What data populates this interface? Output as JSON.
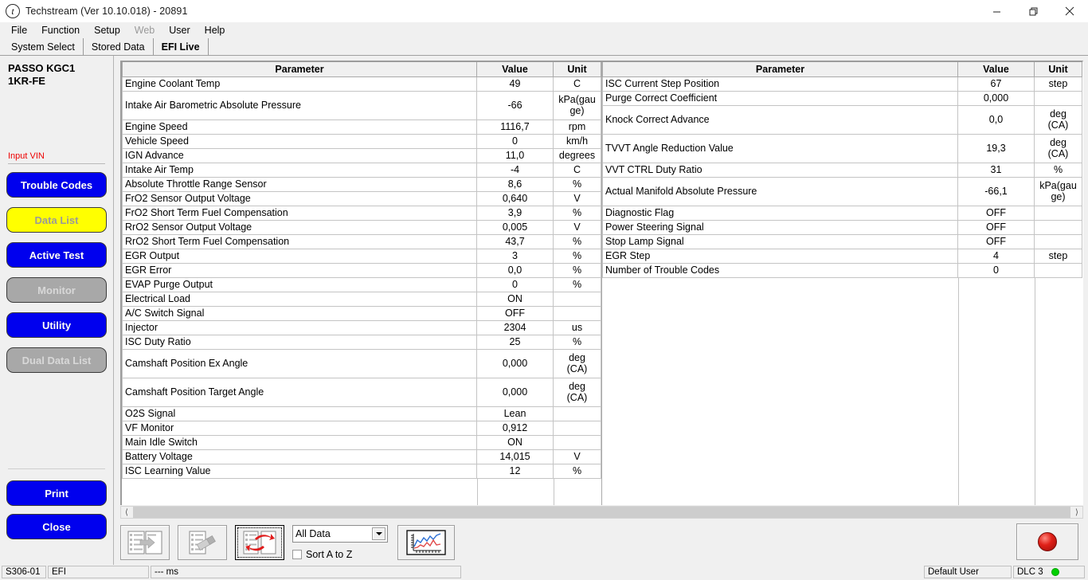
{
  "window": {
    "title": "Techstream (Ver 10.10.018) - 20891",
    "icon": "techstream-logo-icon",
    "minimize": "minimize-icon",
    "maximize": "restore-icon",
    "close": "close-icon"
  },
  "menubar": [
    {
      "label": "File",
      "disabled": false
    },
    {
      "label": "Function",
      "disabled": false
    },
    {
      "label": "Setup",
      "disabled": false
    },
    {
      "label": "Web",
      "disabled": true
    },
    {
      "label": "User",
      "disabled": false
    },
    {
      "label": "Help",
      "disabled": false
    }
  ],
  "tabs": [
    {
      "label": "System Select",
      "active": false
    },
    {
      "label": "Stored Data",
      "active": false
    },
    {
      "label": "EFI Live",
      "active": true
    }
  ],
  "sidebar": {
    "vehicle_line1": "PASSO KGC1",
    "vehicle_line2": "1KR-FE",
    "vin_label": "Input VIN",
    "buttons": [
      {
        "label": "Trouble Codes",
        "style": "blue"
      },
      {
        "label": "Data List",
        "style": "yellow"
      },
      {
        "label": "Active Test",
        "style": "blue"
      },
      {
        "label": "Monitor",
        "style": "gray"
      },
      {
        "label": "Utility",
        "style": "blue"
      },
      {
        "label": "Dual Data List",
        "style": "gray"
      }
    ],
    "bottom_buttons": [
      {
        "label": "Print",
        "style": "blue"
      },
      {
        "label": "Close",
        "style": "blue"
      }
    ]
  },
  "grid": {
    "headers": {
      "parameter": "Parameter",
      "value": "Value",
      "unit": "Unit"
    },
    "left_rows": [
      {
        "parameter": "Engine Coolant Temp",
        "value": "49",
        "unit": "C",
        "tall": false
      },
      {
        "parameter": "Intake Air Barometric Absolute Pressure",
        "value": "-66",
        "unit": "kPa(gauge)",
        "tall": true
      },
      {
        "parameter": "Engine Speed",
        "value": "1116,7",
        "unit": "rpm",
        "tall": false
      },
      {
        "parameter": "Vehicle Speed",
        "value": "0",
        "unit": "km/h",
        "tall": false
      },
      {
        "parameter": "IGN Advance",
        "value": "11,0",
        "unit": "degrees",
        "tall": false
      },
      {
        "parameter": "Intake Air Temp",
        "value": "-4",
        "unit": "C",
        "tall": false
      },
      {
        "parameter": "Absolute Throttle Range Sensor",
        "value": "8,6",
        "unit": "%",
        "tall": false
      },
      {
        "parameter": "FrO2 Sensor Output Voltage",
        "value": "0,640",
        "unit": "V",
        "tall": false
      },
      {
        "parameter": "FrO2 Short Term Fuel Compensation",
        "value": "3,9",
        "unit": "%",
        "tall": false
      },
      {
        "parameter": "RrO2 Sensor Output Voltage",
        "value": "0,005",
        "unit": "V",
        "tall": false
      },
      {
        "parameter": "RrO2 Short Term Fuel Compensation",
        "value": "43,7",
        "unit": "%",
        "tall": false
      },
      {
        "parameter": "EGR Output",
        "value": "3",
        "unit": "%",
        "tall": false
      },
      {
        "parameter": "EGR Error",
        "value": "0,0",
        "unit": "%",
        "tall": false
      },
      {
        "parameter": "EVAP Purge Output",
        "value": "0",
        "unit": "%",
        "tall": false
      },
      {
        "parameter": "Electrical Load",
        "value": "ON",
        "unit": "",
        "tall": false
      },
      {
        "parameter": "A/C Switch Signal",
        "value": "OFF",
        "unit": "",
        "tall": false
      },
      {
        "parameter": "Injector",
        "value": "2304",
        "unit": "us",
        "tall": false
      },
      {
        "parameter": "ISC Duty Ratio",
        "value": "25",
        "unit": "%",
        "tall": false
      },
      {
        "parameter": "Camshaft Position Ex Angle",
        "value": "0,000",
        "unit": "deg (CA)",
        "tall": true
      },
      {
        "parameter": "Camshaft Position Target Angle",
        "value": "0,000",
        "unit": "deg (CA)",
        "tall": true
      },
      {
        "parameter": "O2S Signal",
        "value": "Lean",
        "unit": "",
        "tall": false
      },
      {
        "parameter": "VF Monitor",
        "value": "0,912",
        "unit": "",
        "tall": false
      },
      {
        "parameter": "Main Idle Switch",
        "value": "ON",
        "unit": "",
        "tall": false
      },
      {
        "parameter": "Battery Voltage",
        "value": "14,015",
        "unit": "V",
        "tall": false
      },
      {
        "parameter": "ISC Learning Value",
        "value": "12",
        "unit": "%",
        "tall": false
      }
    ],
    "right_rows": [
      {
        "parameter": "ISC Current Step Position",
        "value": "67",
        "unit": "step",
        "tall": false
      },
      {
        "parameter": "Purge Correct Coefficient",
        "value": "0,000",
        "unit": "",
        "tall": false
      },
      {
        "parameter": "Knock Correct Advance",
        "value": "0,0",
        "unit": "deg (CA)",
        "tall": true
      },
      {
        "parameter": "TVVT Angle Reduction Value",
        "value": "19,3",
        "unit": "deg (CA)",
        "tall": true
      },
      {
        "parameter": "VVT CTRL Duty Ratio",
        "value": "31",
        "unit": "%",
        "tall": false
      },
      {
        "parameter": "Actual Manifold Absolute Pressure",
        "value": "-66,1",
        "unit": "kPa(gauge)",
        "tall": true
      },
      {
        "parameter": "Diagnostic Flag",
        "value": "OFF",
        "unit": "",
        "tall": false
      },
      {
        "parameter": "Power Steering Signal",
        "value": "OFF",
        "unit": "",
        "tall": false
      },
      {
        "parameter": "Stop Lamp Signal",
        "value": "OFF",
        "unit": "",
        "tall": false
      },
      {
        "parameter": "EGR Step",
        "value": "4",
        "unit": "step",
        "tall": false
      },
      {
        "parameter": "Number of Trouble Codes",
        "value": "0",
        "unit": "",
        "tall": false
      }
    ]
  },
  "scrollbar": {
    "left_arrow": "chevron-left-icon",
    "right_arrow": "chevron-right-icon"
  },
  "toolbar": {
    "buttons": [
      {
        "name": "move-to-list-icon",
        "selected": false
      },
      {
        "name": "clear-list-icon",
        "selected": false
      },
      {
        "name": "swap-lists-icon",
        "selected": true
      }
    ],
    "combo": {
      "value": "All Data",
      "arrow": "chevron-down-icon"
    },
    "checkbox": {
      "label": "Sort A to Z",
      "checked": false
    },
    "graph_button": {
      "name": "graph-view-icon"
    },
    "record_button": {
      "name": "record-icon",
      "color": "#e02018"
    }
  },
  "statusbar": {
    "code": "S306-01",
    "system": "EFI",
    "timing": "--- ms",
    "user": "Default User",
    "connection": "DLC 3",
    "connection_color": "#00d000"
  }
}
